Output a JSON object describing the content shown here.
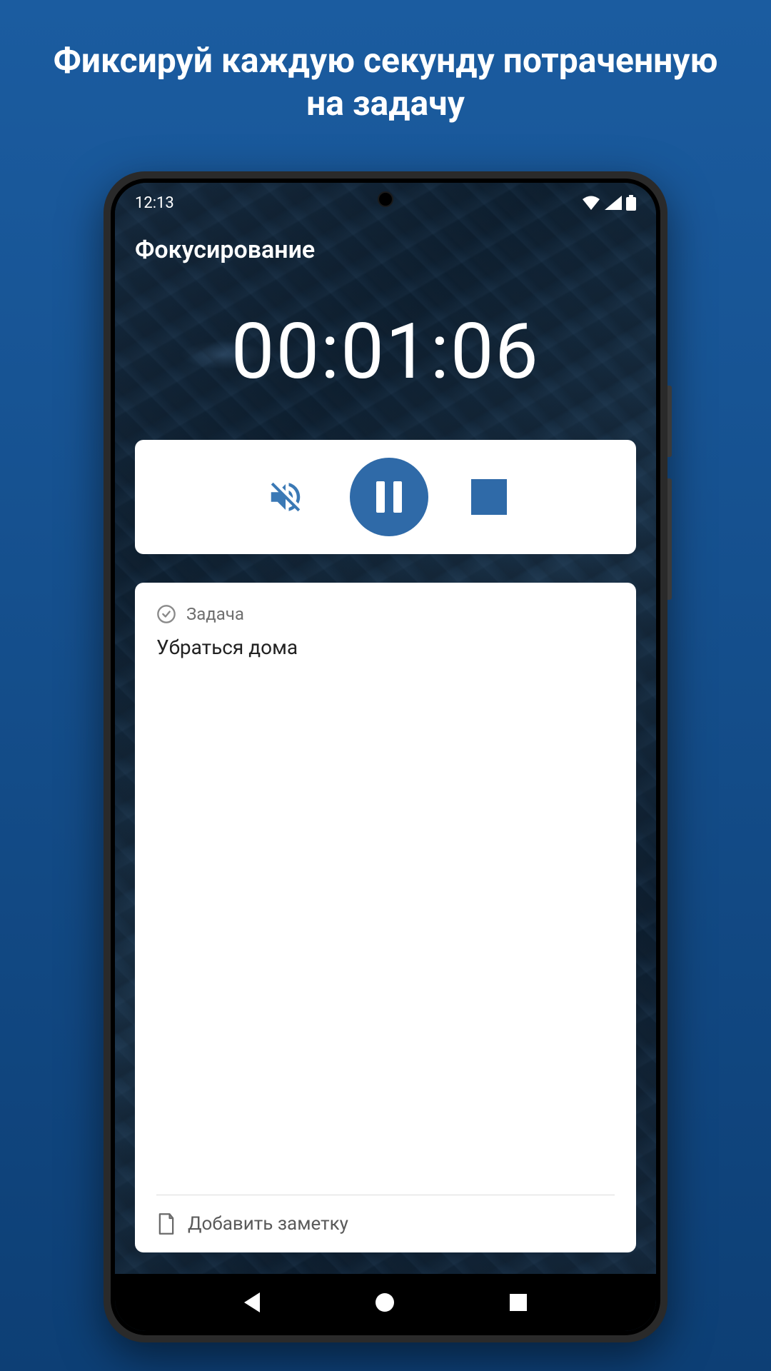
{
  "promo": {
    "title": "Фиксируй каждую секунду потраченную на задачу"
  },
  "status": {
    "time": "12:13"
  },
  "app": {
    "title": "Фокусирование",
    "timer": "00:01:06"
  },
  "task": {
    "label": "Задача",
    "name": "Убраться дома",
    "add_note_label": "Добавить заметку"
  },
  "colors": {
    "accent": "#2f6aa8",
    "bg_gradient_top": "#1b5ca0",
    "bg_gradient_bottom": "#0d3f75"
  }
}
